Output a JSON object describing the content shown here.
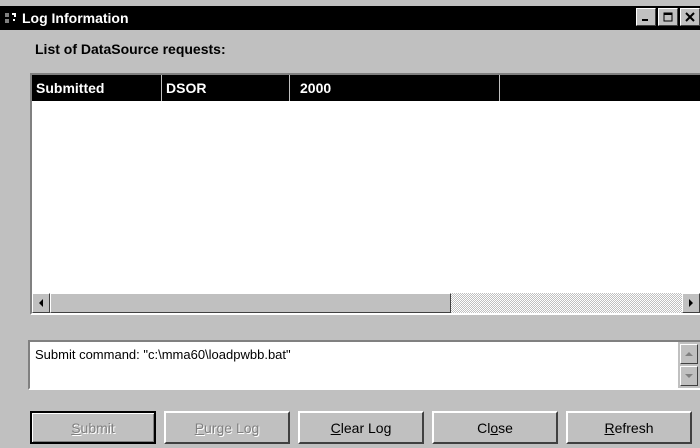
{
  "window": {
    "title": "Log Information"
  },
  "heading": "List of DataSource requests:",
  "list": {
    "columns": [
      "Submitted",
      "DSOR",
      "2000",
      ""
    ],
    "rows": []
  },
  "command": {
    "text": "Submit command: \"c:\\mma60\\loadpwbb.bat\""
  },
  "buttons": {
    "submit": {
      "accel": "S",
      "rest": "ubmit",
      "enabled": false
    },
    "purge": {
      "accel": "P",
      "rest": "urge Log",
      "enabled": false
    },
    "clear": {
      "accel": "C",
      "rest": "lear Log",
      "enabled": true
    },
    "close": {
      "pre": "Cl",
      "accel": "o",
      "rest": "se",
      "enabled": true
    },
    "refresh": {
      "accel": "R",
      "rest": "efresh",
      "enabled": true
    }
  },
  "icons": {
    "app": "app-icon",
    "minimize": "minimize-icon",
    "maximize": "maximize-icon",
    "close": "close-icon",
    "scroll_left": "arrow-left-icon",
    "scroll_right": "arrow-right-icon",
    "scroll_up": "arrow-up-icon",
    "scroll_down": "arrow-down-icon"
  },
  "colors": {
    "titlebar": "#000000",
    "face": "#c0c0c0",
    "disabled_text": "#808080"
  }
}
